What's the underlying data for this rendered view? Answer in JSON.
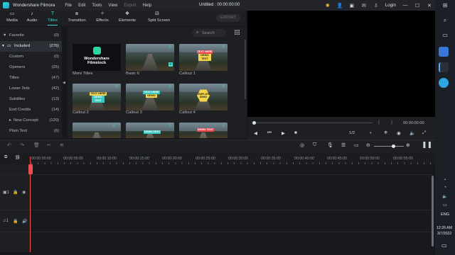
{
  "app": {
    "name": "Wondershare Filmora",
    "project_title": "Untitled : 00:00:00:00",
    "menus": [
      {
        "label": "File",
        "disabled": false
      },
      {
        "label": "Edit",
        "disabled": false
      },
      {
        "label": "Tools",
        "disabled": false
      },
      {
        "label": "View",
        "disabled": false
      },
      {
        "label": "Export",
        "disabled": true
      },
      {
        "label": "Help",
        "disabled": false
      }
    ],
    "login": "Login"
  },
  "toolbar": {
    "tabs": [
      {
        "label": "Media",
        "icon": "folder-icon"
      },
      {
        "label": "Audio",
        "icon": "music-icon"
      },
      {
        "label": "Titles",
        "icon": "text-icon",
        "active": true
      },
      {
        "label": "Transition",
        "icon": "transition-icon"
      },
      {
        "label": "Effects",
        "icon": "effects-icon"
      },
      {
        "label": "Elements",
        "icon": "elements-icon"
      },
      {
        "label": "Split Screen",
        "icon": "split-screen-icon"
      }
    ],
    "export_label": "EXPORT",
    "accent": "#3fd7c9"
  },
  "categories": [
    {
      "label": "Favorite",
      "count": "(0)",
      "prefix": "♥"
    },
    {
      "label": "Included",
      "count": "(276)",
      "prefix": "▾",
      "selected": true
    },
    {
      "label": "Custom",
      "count": "(0)"
    },
    {
      "label": "Openers",
      "count": "(25)"
    },
    {
      "label": "Titles",
      "count": "(47)"
    },
    {
      "label": "Lower 3rds",
      "count": "(42)"
    },
    {
      "label": "Subtitles",
      "count": "(13)"
    },
    {
      "label": "End Credits",
      "count": "(14)"
    },
    {
      "label": "New Concept",
      "count": "(120)",
      "prefix": "▸"
    },
    {
      "label": "Plain Text",
      "count": "(6)"
    }
  ],
  "search": {
    "placeholder": "Search"
  },
  "thumbnails": [
    {
      "label": "More Titles",
      "banner": "Wondershare Filmstock"
    },
    {
      "label": "Basic 6"
    },
    {
      "label": "Callout 1",
      "banner": "TEXT HERE",
      "sub": "DEMO TEXT"
    },
    {
      "label": "Callout 2",
      "banner": "TEXT HERE",
      "sub": "DEMO TEXT"
    },
    {
      "label": "Callout 3",
      "banner": "TEXT HERE",
      "sub": "DEMO"
    },
    {
      "label": "Callout 4",
      "banner": "TEMPLATE DEMO"
    },
    {
      "label": ""
    },
    {
      "label": "",
      "banner": "DEMO TEXT"
    },
    {
      "label": "",
      "banner": "DEMO TEXT"
    }
  ],
  "preview": {
    "time": "00:00:00:00",
    "ratio": "1/2"
  },
  "timeline": {
    "ruler": [
      "00:00:00:00",
      "00:00:05:00",
      "00:00:10:00",
      "00:00:15:00",
      "00:00:20:00",
      "00:00:25:00",
      "00:00:30:00",
      "00:00:35:00",
      "00:00:40:00",
      "00:00:45:00",
      "00:00:50:00",
      "00:00:55:00"
    ]
  },
  "taskbar": {
    "lang": "ENG",
    "time": "12:26 AM",
    "date": "3/7/2022"
  }
}
